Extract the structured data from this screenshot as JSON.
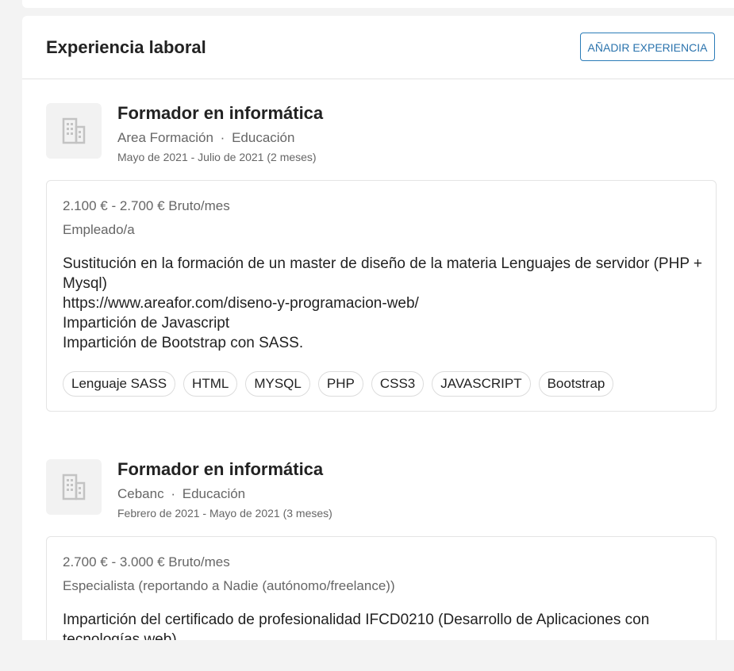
{
  "section": {
    "title": "Experiencia laboral",
    "add_button": "AÑADIR EXPERIENCIA"
  },
  "experiences": [
    {
      "title": "Formador en informática",
      "company": "Area Formación",
      "sector": "Educación",
      "separator": "·",
      "dates": "Mayo de 2021 - Julio de 2021 (2 meses)",
      "salary": "2.100 € - 2.700 € Bruto/mes",
      "contract": "Empleado/a",
      "description": "Sustitución en la formación de un master de diseño de la materia Lenguajes de servidor (PHP + Mysql)\nhttps://www.areafor.com/diseno-y-programacion-web/\nImpartición de Javascript\nImpartición de Bootstrap con SASS.",
      "tags": [
        "Lenguaje SASS",
        "HTML",
        "MYSQL",
        "PHP",
        "CSS3",
        "JAVASCRIPT",
        "Bootstrap"
      ],
      "logo_icon": "building-icon"
    },
    {
      "title": "Formador en informática",
      "company": "Cebanc",
      "sector": "Educación",
      "separator": "·",
      "dates": "Febrero de 2021 - Mayo de 2021 (3 meses)",
      "salary": "2.700 € - 3.000 € Bruto/mes",
      "contract": "Especialista (reportando a Nadie (autónomo/freelance))",
      "description": "Impartición del certificado de profesionalidad IFCD0210 (Desarrollo de Aplicaciones con tecnologías web)",
      "logo_icon": "building-icon"
    }
  ],
  "colors": {
    "accent": "#2b7cb8",
    "page_bg": "#f3f3f3",
    "muted_text": "#666666"
  }
}
